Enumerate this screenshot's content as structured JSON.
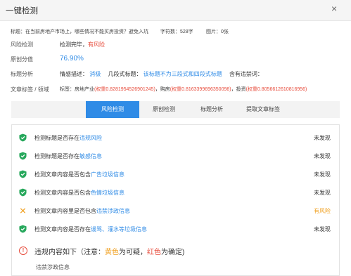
{
  "window": {
    "title": "一键检测",
    "close_label": "×"
  },
  "meta": {
    "title_text": "标题：在当前房地产市场上，哪些情况不能买房投资？避免入坑",
    "word_count": "字符数：528字",
    "images": "图片：0张"
  },
  "risk": {
    "label": "风险检测",
    "value_prefix": "检测完毕，",
    "value_flag": "有风险"
  },
  "originality": {
    "label": "原创分值",
    "value": "76.90%"
  },
  "title_analysis": {
    "label": "标题分析",
    "emotion_label": "情感描述：",
    "emotion_value": "消极",
    "structure_label": "几段式标题：",
    "structure_value": "该标题不为三段式和四段式标题",
    "banned_label": "含有违禁词："
  },
  "tags": {
    "label": "文章标签 / 领域",
    "prefix": "标签：",
    "items": [
      {
        "name": "房地产业",
        "weight": "(权重0.8281954526901245)"
      },
      {
        "name": "购房",
        "weight": "(权重0.8163399696350098)"
      },
      {
        "name": "投资",
        "weight": "(权重0.8056612610816956)"
      }
    ],
    "separator": "，"
  },
  "tabs": [
    {
      "label": "风险检测",
      "active": true
    },
    {
      "label": "原创检测",
      "active": false
    },
    {
      "label": "标题分析",
      "active": false
    },
    {
      "label": "提取文章标签",
      "active": false
    }
  ],
  "checks": [
    {
      "text": "检测标题是否存在",
      "link": "违规风险",
      "result": "未发现",
      "status": "ok"
    },
    {
      "text": "检测标题是否存在",
      "link": "敏感信息",
      "result": "未发现",
      "status": "ok"
    },
    {
      "text": "检测文章内容是否包含",
      "link": "广告垃圾信息",
      "result": "未发现",
      "status": "ok"
    },
    {
      "text": "检测文章内容是否包含",
      "link": "色情垃圾信息",
      "result": "未发现",
      "status": "ok"
    },
    {
      "text": "检测文章内容里是否包含",
      "link": "违禁涉政信息",
      "result": "有风险",
      "status": "warn"
    },
    {
      "text": "检测文章内容是否存在",
      "link": "谩骂、灌水等垃圾信息",
      "result": "未发现",
      "status": "ok"
    }
  ],
  "summary": {
    "title_a": "违规内容如下（注意：",
    "yellow_word": "黄色",
    "title_b": "为可疑，",
    "red_word": "红色",
    "title_c": "为确定)",
    "item": "违禁涉政信息"
  },
  "colors": {
    "accent": "#2f8be6",
    "ok": "#27a85c",
    "warn": "#f0a020",
    "danger": "#e74c3c"
  }
}
